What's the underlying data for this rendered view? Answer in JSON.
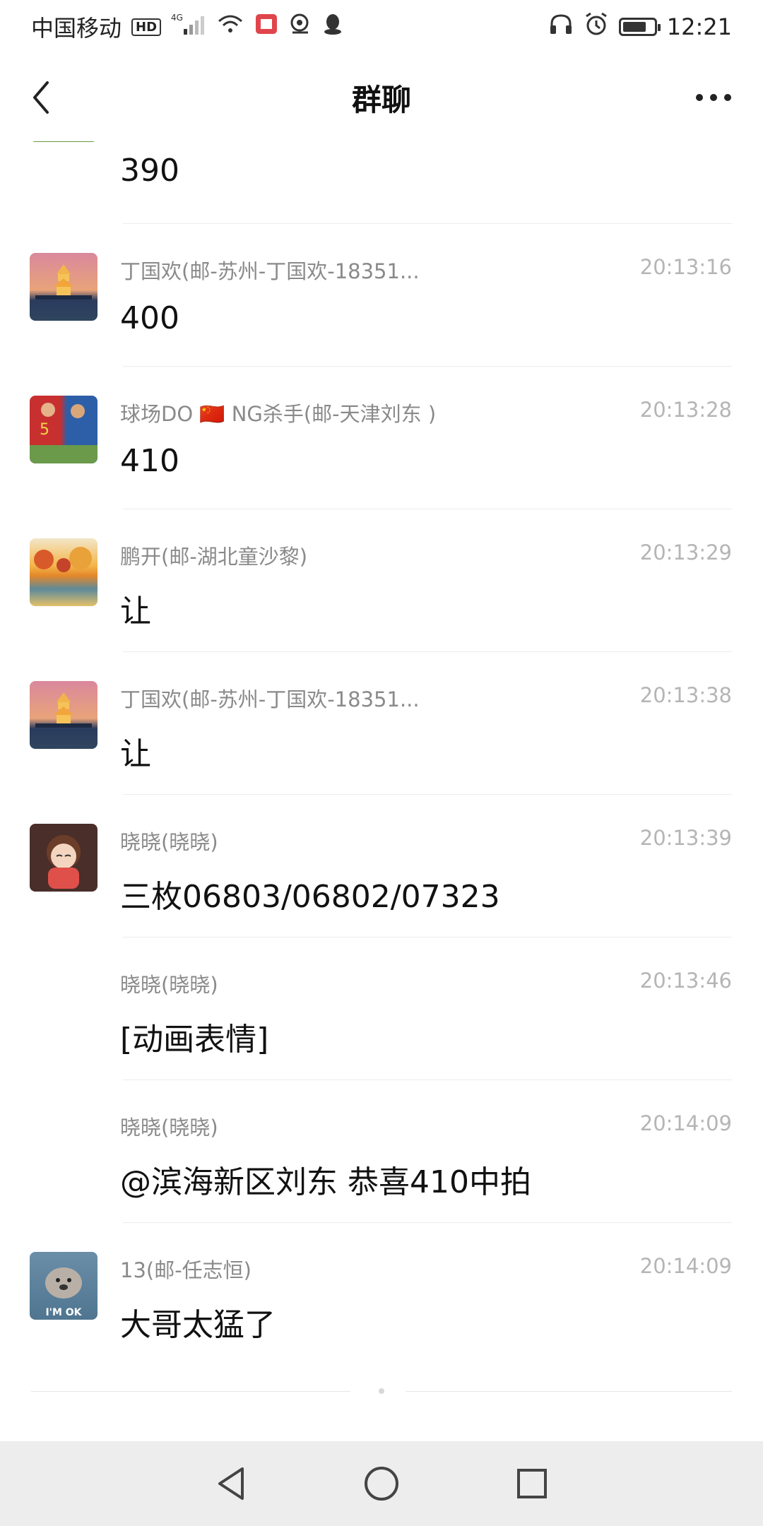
{
  "status_bar": {
    "carrier": "中国移动",
    "hd": "HD",
    "signal": "4G",
    "time": "12:21",
    "battery_level": 0.75,
    "icons": [
      "hd-icon",
      "signal-icon",
      "wifi-icon",
      "app-notification-icon",
      "camera-icon",
      "qq-icon",
      "headphones-icon",
      "alarm-icon",
      "battery-icon"
    ]
  },
  "header": {
    "title": "群聊",
    "back_icon": "chevron-left-icon",
    "more_icon": "more-dots-icon"
  },
  "messages": [
    {
      "sender": "",
      "time": "",
      "content": "390",
      "avatar": "football-players"
    },
    {
      "sender": "丁国欢(邮-苏州-丁国欢-18351...",
      "time": "20:13:16",
      "content": "400",
      "avatar": "pagoda-sunset"
    },
    {
      "sender": "球场DO 🇨🇳 NG杀手(邮-天津刘东 )",
      "time": "20:13:28",
      "content": "410",
      "avatar": "football-players"
    },
    {
      "sender": "鹏开(邮-湖北童沙黎)",
      "time": "20:13:29",
      "content": "让",
      "avatar": "autumn-lake"
    },
    {
      "sender": "丁国欢(邮-苏州-丁国欢-18351...",
      "time": "20:13:38",
      "content": "让",
      "avatar": "pagoda-sunset"
    },
    {
      "sender": "晓晓(晓晓)",
      "time": "20:13:39",
      "content": "三枚06803/06802/07323",
      "avatar": "cartoon-girl"
    },
    {
      "sender": "晓晓(晓晓)",
      "time": "20:13:46",
      "content": "[动画表情]",
      "avatar": ""
    },
    {
      "sender": "晓晓(晓晓)",
      "time": "20:14:09",
      "content": "@滨海新区刘东 恭喜410中拍",
      "avatar": ""
    },
    {
      "sender": "13(邮-任志恒)",
      "time": "20:14:09",
      "content": "大哥太猛了",
      "avatar": "seal-im-ok",
      "avatar_text": "I'M OK"
    }
  ],
  "nav_bar": {
    "back_icon": "triangle-back-icon",
    "home_icon": "circle-home-icon",
    "recents_icon": "square-recents-icon"
  }
}
